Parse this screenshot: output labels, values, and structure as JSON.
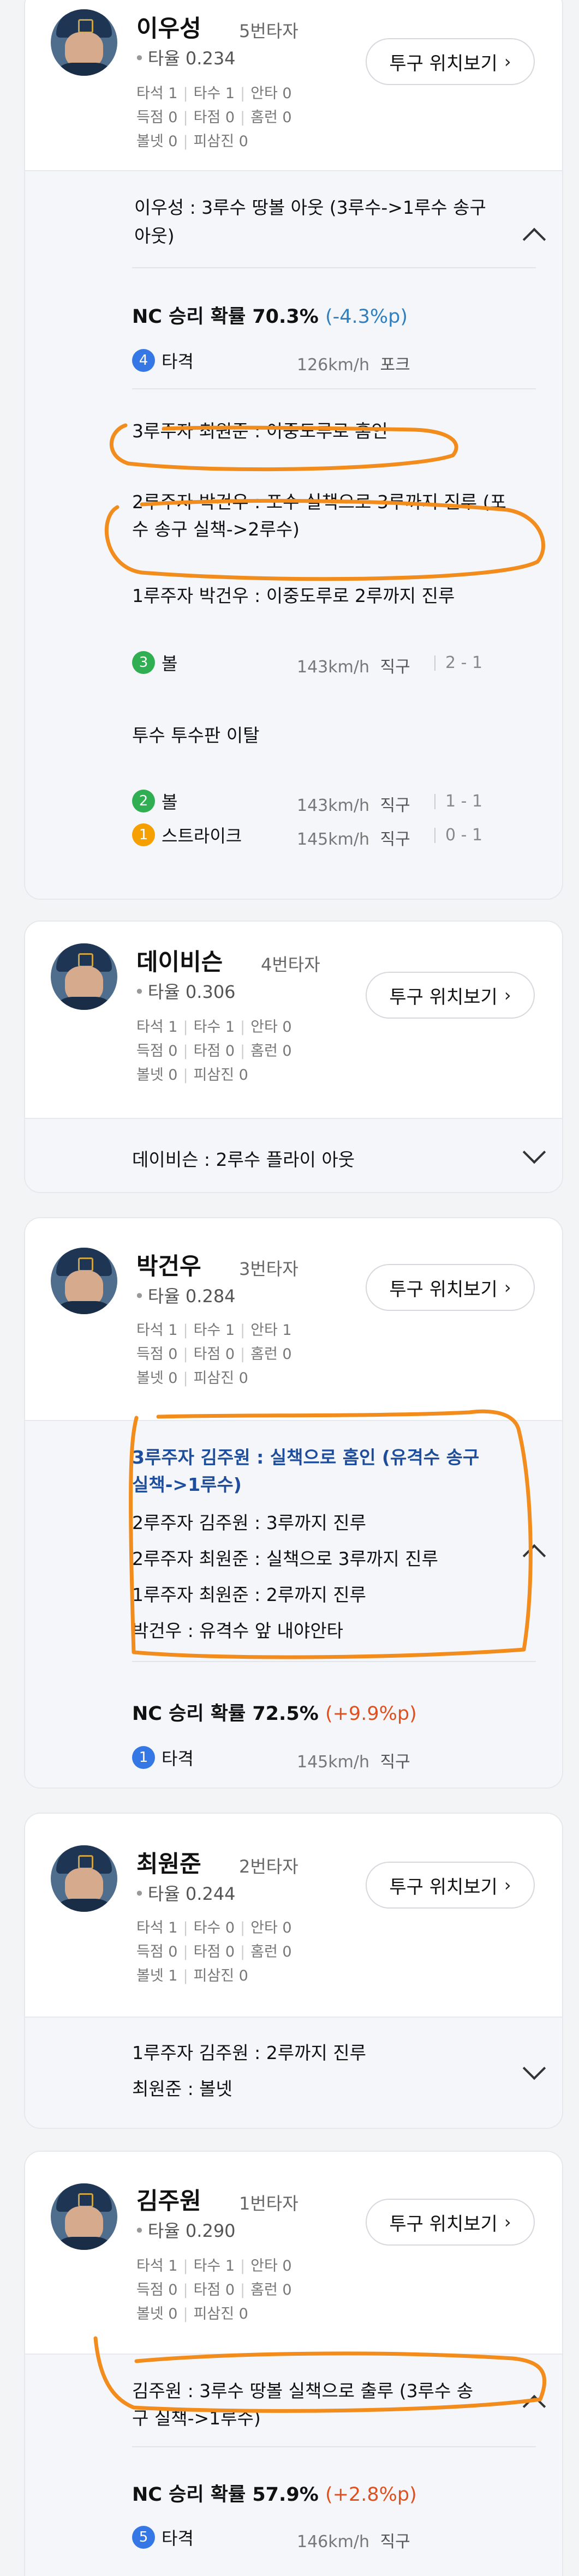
{
  "players": [
    {
      "name": "이우성",
      "order": "5번타자",
      "avg": "타율 0.234",
      "stats": [
        [
          "타석 1",
          "타수 1",
          "안타 0"
        ],
        [
          "득점 0",
          "타점 0",
          "홈런 0"
        ],
        [
          "볼넷 0",
          "피삼진 0"
        ]
      ],
      "pitch_btn": "투구 위치보기",
      "events": [
        "이우성 : 3루수 땅볼 아웃 (3루수->1루수 송구",
        "아웃)"
      ],
      "win_label": "NC 승리 확률 70.3%",
      "win_delta": "(-4.3%p)",
      "pitches": [
        {
          "num": "4",
          "type": "타격",
          "speed": "126km/h",
          "kind": "포크",
          "count": ""
        },
        {
          "num": "3",
          "type": "볼",
          "speed": "143km/h",
          "kind": "직구",
          "count": "2 - 1"
        },
        {
          "num": "2",
          "type": "볼",
          "speed": "143km/h",
          "kind": "직구",
          "count": "1 - 1"
        },
        {
          "num": "1",
          "type": "스트라이크",
          "speed": "145km/h",
          "kind": "직구",
          "count": "0 - 1"
        }
      ],
      "runner_events": [
        "3루주자 최원준 : 이중도루로 홈인",
        "2루주자 박건우 : 포수 실책으로 3루까지 진루 (포",
        "수 송구 실책->2루수)",
        "1루주자 박건우 : 이중도루로 2루까지 진루",
        "투수 투수판 이탈"
      ]
    },
    {
      "name": "데이비슨",
      "order": "4번타자",
      "avg": "타율 0.306",
      "stats": [
        [
          "타석 1",
          "타수 1",
          "안타 0"
        ],
        [
          "득점 0",
          "타점 0",
          "홈런 0"
        ],
        [
          "볼넷 0",
          "피삼진 0"
        ]
      ],
      "pitch_btn": "투구 위치보기",
      "events": [
        "데이비슨 : 2루수 플라이 아웃"
      ]
    },
    {
      "name": "박건우",
      "order": "3번타자",
      "avg": "타율 0.284",
      "stats": [
        [
          "타석 1",
          "타수 1",
          "안타 1"
        ],
        [
          "득점 0",
          "타점 0",
          "홈런 0"
        ],
        [
          "볼넷 0",
          "피삼진 0"
        ]
      ],
      "pitch_btn": "투구 위치보기",
      "events": [
        "3루주자 김주원 : 실책으로 홈인 (유격수 송구",
        "실책->1루수)",
        "2루주자 김주원 : 3루까지 진루",
        "2루주자 최원준 : 실책으로 3루까지 진루",
        "1루주자 최원준 : 2루까지 진루",
        "박건우 : 유격수 앞 내야안타"
      ],
      "win_label": "NC 승리 확률 72.5%",
      "win_delta": "(+9.9%p)",
      "pitches": [
        {
          "num": "1",
          "type": "타격",
          "speed": "145km/h",
          "kind": "직구",
          "count": ""
        }
      ]
    },
    {
      "name": "최원준",
      "order": "2번타자",
      "avg": "타율 0.244",
      "stats": [
        [
          "타석 1",
          "타수 0",
          "안타 0"
        ],
        [
          "득점 0",
          "타점 0",
          "홈런 0"
        ],
        [
          "볼넷 1",
          "피삼진 0"
        ]
      ],
      "pitch_btn": "투구 위치보기",
      "events": [
        "1루주자 김주원 : 2루까지 진루",
        "최원준 : 볼넷"
      ]
    },
    {
      "name": "김주원",
      "order": "1번타자",
      "avg": "타율 0.290",
      "stats": [
        [
          "타석 1",
          "타수 1",
          "안타 0"
        ],
        [
          "득점 0",
          "타점 0",
          "홈런 0"
        ],
        [
          "볼넷 0",
          "피삼진 0"
        ]
      ],
      "pitch_btn": "투구 위치보기",
      "events": [
        "김주원 : 3루수 땅볼 실책으로 출루 (3루수 송",
        "구 실책->1루수)"
      ],
      "win_label": "NC 승리 확률 57.9%",
      "win_delta": "(+2.8%p)",
      "pitches": [
        {
          "num": "5",
          "type": "타격",
          "speed": "146km/h",
          "kind": "직구",
          "count": ""
        }
      ]
    }
  ],
  "colors": {
    "accent_blue": "#1e4d9c",
    "negative": "#2f7fc1",
    "positive": "#e0501f",
    "highlight": "#f28c1c"
  }
}
